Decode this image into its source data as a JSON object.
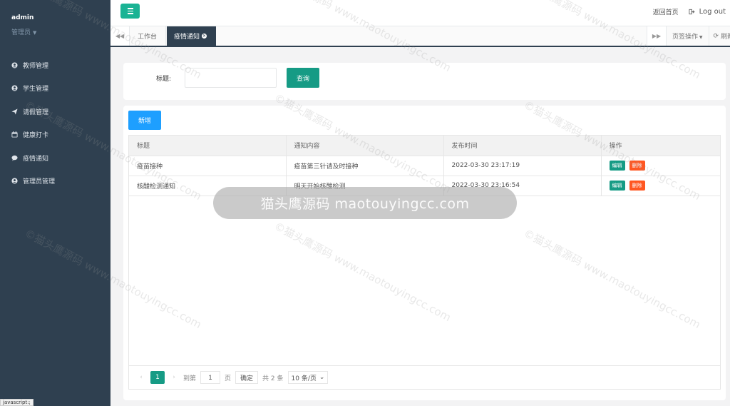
{
  "sidebar": {
    "user_name": "admin",
    "user_role": "管理员",
    "items": [
      {
        "label": "教师管理",
        "icon": "user-circle-icon"
      },
      {
        "label": "学生管理",
        "icon": "user-circle-icon"
      },
      {
        "label": "请假管理",
        "icon": "paper-plane-icon"
      },
      {
        "label": "健康打卡",
        "icon": "calendar-icon"
      },
      {
        "label": "疫情通知",
        "icon": "comment-icon"
      },
      {
        "label": "管理员管理",
        "icon": "user-circle-icon"
      }
    ]
  },
  "header": {
    "home_link": "返回首页",
    "logout_label": "Log out"
  },
  "tabs": {
    "items": [
      {
        "label": "工作台",
        "active": false
      },
      {
        "label": "疫情通知",
        "active": true
      }
    ],
    "page_ops_label": "页签操作",
    "refresh_label": "刷新"
  },
  "search": {
    "label": "标题:",
    "value": "",
    "button_label": "查询"
  },
  "toolbar": {
    "add_label": "新增"
  },
  "table": {
    "headers": [
      "标题",
      "通知内容",
      "发布时间",
      "操作"
    ],
    "rows": [
      {
        "title": "疫苗接种",
        "content": "疫苗第三针请及时接种",
        "time": "2022-03-30 23:17:19"
      },
      {
        "title": "核酸检测通知",
        "content": "明天开始核酸检测",
        "time": "2022-03-30 23:16:54"
      }
    ],
    "edit_label": "编辑",
    "delete_label": "删除"
  },
  "pager": {
    "current_page": "1",
    "goto_label": "到第",
    "goto_value": "1",
    "page_unit": "页",
    "confirm_label": "确定",
    "total_label": "共 2 条",
    "page_size": "10 条/页"
  },
  "watermark": {
    "band_text": "猫头鹰源码 maotouyingcc.com",
    "tile_text": "©猫头鹰源码 www.maotouyingcc.com"
  },
  "status_bar": {
    "text": "javascript:;"
  },
  "colors": {
    "sidebar_bg": "#2f4050",
    "accent_green": "#1ab394",
    "button_teal": "#169b85",
    "button_blue": "#1e9fff",
    "delete_orange": "#ff5722"
  }
}
